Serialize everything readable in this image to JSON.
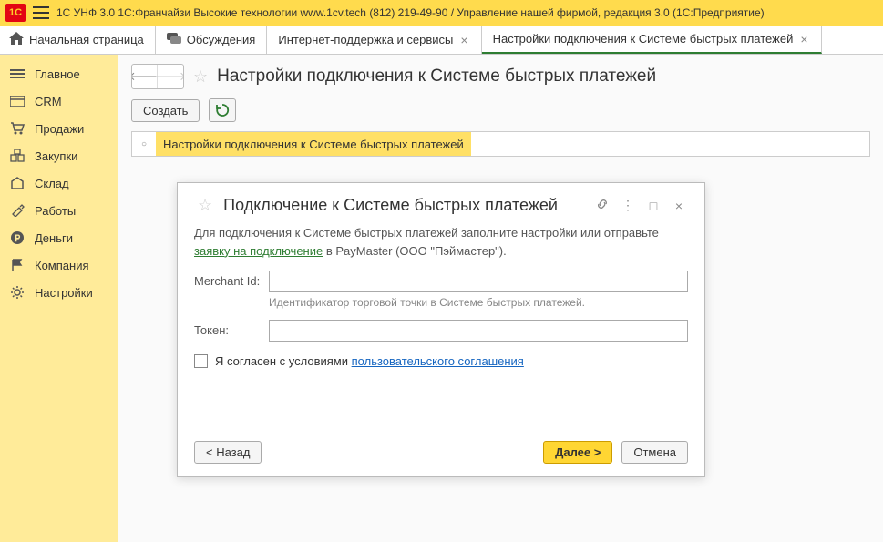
{
  "titlebar": "1С УНФ 3.0 1С:Франчайзи Высокие технологии www.1cv.tech (812) 219-49-90 / Управление нашей фирмой, редакция 3.0  (1С:Предприятие)",
  "tabs": {
    "home": "Начальная страница",
    "discuss": "Обсуждения",
    "support": "Интернет-поддержка и сервисы",
    "sbp": "Настройки подключения к Системе быстрых платежей"
  },
  "sidebar": [
    {
      "label": "Главное"
    },
    {
      "label": "CRM"
    },
    {
      "label": "Продажи"
    },
    {
      "label": "Закупки"
    },
    {
      "label": "Склад"
    },
    {
      "label": "Работы"
    },
    {
      "label": "Деньги"
    },
    {
      "label": "Компания"
    },
    {
      "label": "Настройки"
    }
  ],
  "page": {
    "title": "Настройки подключения к Системе быстрых платежей",
    "create": "Создать",
    "list_item": "Настройки подключения к Системе быстрых платежей"
  },
  "dialog": {
    "title": "Подключение к Системе быстрых платежей",
    "intro1": "Для подключения к Системе быстрых платежей заполните настройки или отправьте ",
    "intro_link": "заявку на подключение",
    "intro2": " в PayMaster (ООО \"Пэймастер\").",
    "merchant_label": "Merchant Id:",
    "merchant_hint": "Идентификатор торговой точки в Системе быстрых платежей.",
    "token_label": "Токен:",
    "agree_prefix": "Я согласен с условиями ",
    "agree_link": "пользовательского соглашения",
    "back": "< Назад",
    "next": "Далее >",
    "cancel": "Отмена"
  }
}
